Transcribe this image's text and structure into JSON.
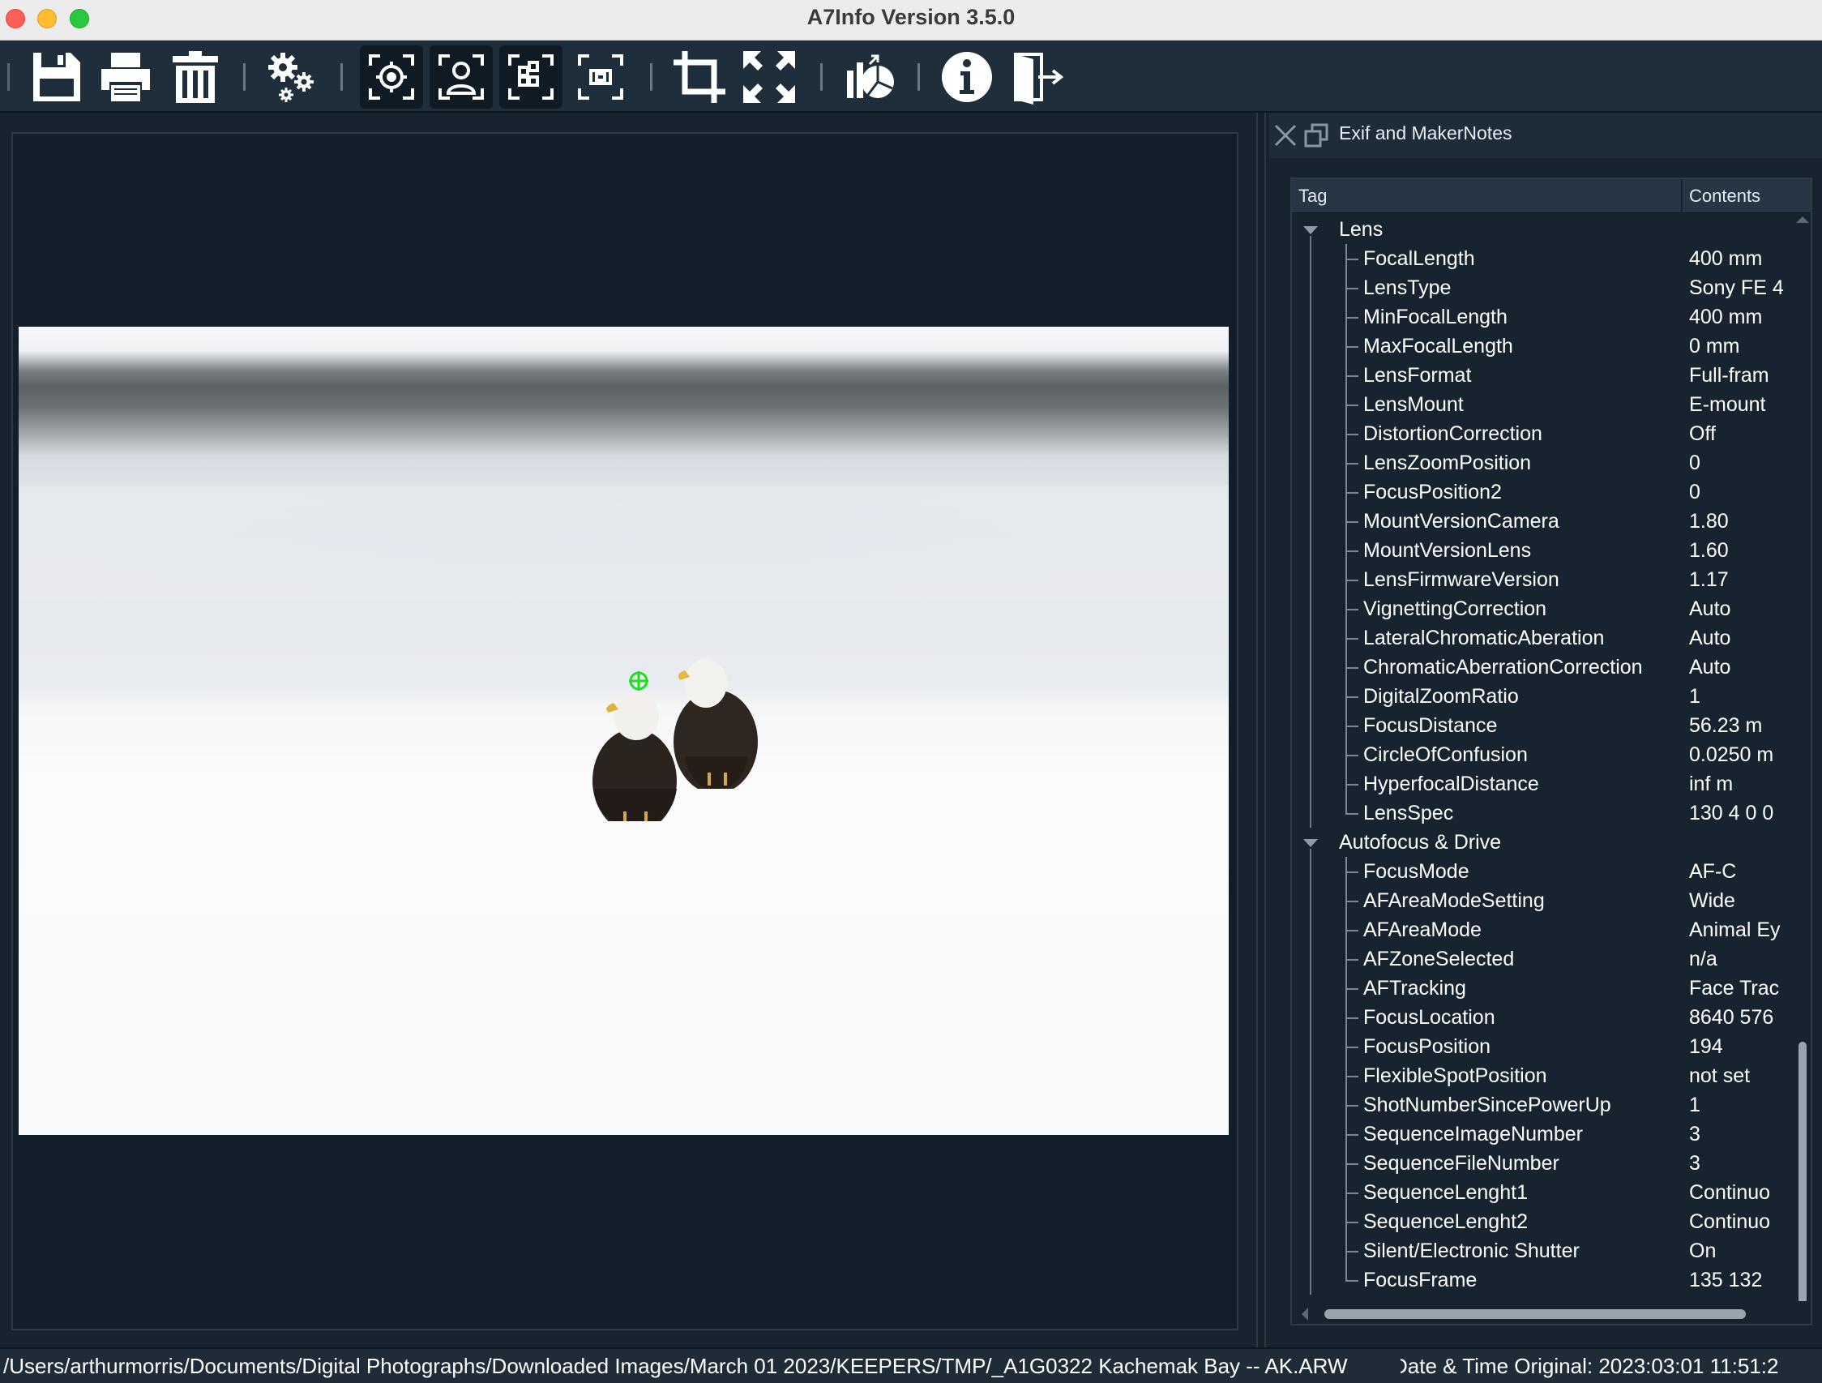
{
  "window": {
    "title": "A7Info Version 3.5.0"
  },
  "toolbar": {
    "buttons": [
      {
        "name": "save-button",
        "icon": "floppy-disk-icon"
      },
      {
        "name": "print-button",
        "icon": "printer-icon"
      },
      {
        "name": "delete-button",
        "icon": "trash-icon"
      },
      {
        "name": "settings-button",
        "icon": "gears-icon"
      },
      {
        "name": "focus-point-button",
        "icon": "focus-point-icon"
      },
      {
        "name": "face-detect-button",
        "icon": "face-frame-icon"
      },
      {
        "name": "af-area-button",
        "icon": "af-grid-icon"
      },
      {
        "name": "frame-button",
        "icon": "frame-icon"
      },
      {
        "name": "crop-button",
        "icon": "crop-icon"
      },
      {
        "name": "fullscreen-button",
        "icon": "expand-icon"
      },
      {
        "name": "stats-button",
        "icon": "chart-icon"
      },
      {
        "name": "info-button",
        "icon": "info-icon"
      },
      {
        "name": "exit-button",
        "icon": "exit-door-icon"
      }
    ]
  },
  "panel": {
    "title": "Exif and MakerNotes",
    "columns": {
      "tag": "Tag",
      "contents": "Contents"
    },
    "groups": [
      {
        "label": "Lens",
        "items": [
          {
            "tag": "FocalLength",
            "value": "400 mm"
          },
          {
            "tag": "LensType",
            "value": "Sony FE 4"
          },
          {
            "tag": "MinFocalLength",
            "value": "400 mm"
          },
          {
            "tag": "MaxFocalLength",
            "value": "0 mm"
          },
          {
            "tag": "LensFormat",
            "value": "Full-fram"
          },
          {
            "tag": "LensMount",
            "value": "E-mount"
          },
          {
            "tag": "DistortionCorrection",
            "value": "Off"
          },
          {
            "tag": "LensZoomPosition",
            "value": "0"
          },
          {
            "tag": "FocusPosition2",
            "value": "0"
          },
          {
            "tag": "MountVersionCamera",
            "value": "1.80"
          },
          {
            "tag": "MountVersionLens",
            "value": "1.60"
          },
          {
            "tag": "LensFirmwareVersion",
            "value": "1.17"
          },
          {
            "tag": "VignettingCorrection",
            "value": "Auto"
          },
          {
            "tag": "LateralChromaticAberation",
            "value": "Auto"
          },
          {
            "tag": "ChromaticAberrationCorrection",
            "value": "Auto"
          },
          {
            "tag": "DigitalZoomRatio",
            "value": "1"
          },
          {
            "tag": "FocusDistance",
            "value": "56.23 m"
          },
          {
            "tag": "CircleOfConfusion",
            "value": "0.0250 m"
          },
          {
            "tag": "HyperfocalDistance",
            "value": "inf m"
          },
          {
            "tag": "LensSpec",
            "value": "130 4 0 0"
          }
        ]
      },
      {
        "label": "Autofocus & Drive",
        "items": [
          {
            "tag": "FocusMode",
            "value": "AF-C"
          },
          {
            "tag": "AFAreaModeSetting",
            "value": "Wide"
          },
          {
            "tag": "AFAreaMode",
            "value": "Animal Ey"
          },
          {
            "tag": "AFZoneSelected",
            "value": "n/a"
          },
          {
            "tag": "AFTracking",
            "value": "Face Trac"
          },
          {
            "tag": "FocusLocation",
            "value": "8640 576"
          },
          {
            "tag": "FocusPosition",
            "value": "194"
          },
          {
            "tag": "FlexibleSpotPosition",
            "value": "not set"
          },
          {
            "tag": "ShotNumberSincePowerUp",
            "value": "1"
          },
          {
            "tag": "SequenceImageNumber",
            "value": "3"
          },
          {
            "tag": "SequenceFileNumber",
            "value": "3"
          },
          {
            "tag": "SequenceLenght1",
            "value": "Continuo"
          },
          {
            "tag": "SequenceLenght2",
            "value": "Continuo"
          },
          {
            "tag": "Silent/Electronic Shutter",
            "value": "On"
          },
          {
            "tag": "FocusFrame",
            "value": "135 132"
          }
        ]
      }
    ]
  },
  "status": {
    "path": "/Users/arthurmorris/Documents/Digital Photographs/Downloaded Images/March 01 2023/KEEPERS/TMP/_A1G0322  Kachemak Bay -- AK.ARW",
    "datetime": "Date & Time Original: 2023:03:01 11:51:2"
  },
  "colors": {
    "background": "#17232f",
    "toolbar": "#1f2e3b",
    "focus_marker": "#22dd22"
  }
}
